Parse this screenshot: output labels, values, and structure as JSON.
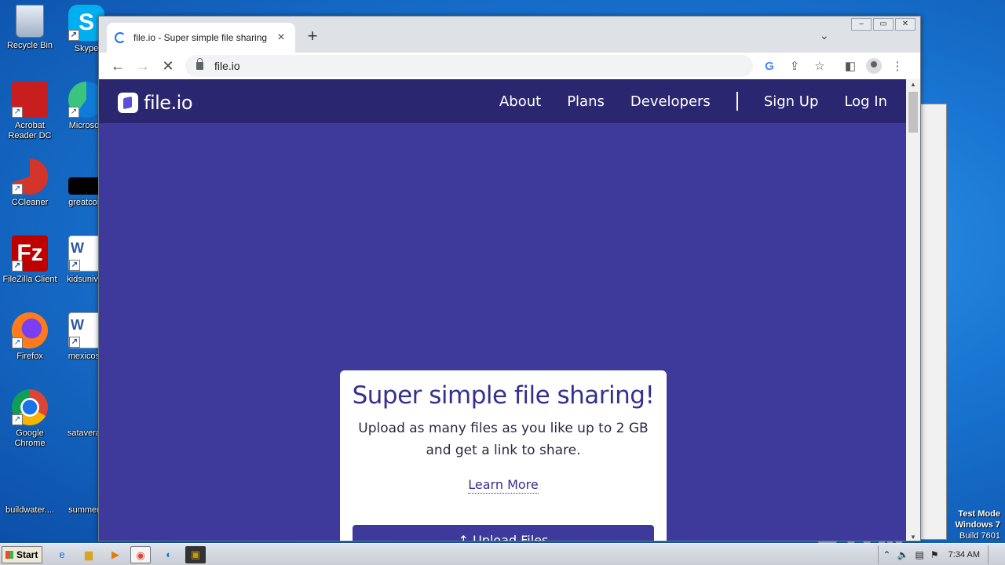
{
  "desktop": {
    "icons": [
      {
        "label": "Recycle Bin",
        "icon": "recycle-bin-icon"
      },
      {
        "label": "Skype",
        "icon": "skype-icon"
      },
      {
        "label": "Acrobat Reader DC",
        "icon": "acrobat-icon"
      },
      {
        "label": "Microsoft",
        "icon": "edge-icon"
      },
      {
        "label": "CCleaner",
        "icon": "ccleaner-icon"
      },
      {
        "label": "greatcom",
        "icon": "black-file-icon"
      },
      {
        "label": "FileZilla Client",
        "icon": "filezilla-icon"
      },
      {
        "label": "kidsuniver",
        "icon": "word-doc-icon"
      },
      {
        "label": "Firefox",
        "icon": "firefox-icon"
      },
      {
        "label": "mexicose",
        "icon": "word-doc-icon"
      },
      {
        "label": "Google Chrome",
        "icon": "chrome-icon"
      },
      {
        "label": "sataverag",
        "icon": "blank-file-icon"
      },
      {
        "label": "buildwater....",
        "icon": "blank-file-icon"
      },
      {
        "label": "summerg",
        "icon": "blank-file-icon"
      }
    ],
    "watermark": "ANY RUN",
    "testmode": {
      "line1": "Test Mode",
      "line2": "Windows 7",
      "line3": "Build 7601"
    }
  },
  "browser": {
    "tab_title": "file.io - Super simple file sharing",
    "tab_close": "×",
    "new_tab": "+",
    "tab_search": "⌄",
    "url": "file.io",
    "win_controls": {
      "minimize": "‒",
      "maximize": "▭",
      "close": "✕"
    }
  },
  "site": {
    "logo_text": "file.io",
    "nav": {
      "about": "About",
      "plans": "Plans",
      "developers": "Developers",
      "signup": "Sign Up",
      "login": "Log In"
    },
    "card": {
      "heading": "Super simple file sharing!",
      "description": "Upload as many files as you like up to 2 GB and get a link to share.",
      "learn_more": "Learn More",
      "upload": "↑ Upload Files"
    }
  },
  "taskbar": {
    "start_label": "Start",
    "clock": "7:34 AM"
  },
  "colors": {
    "site_nav": "#2a2770",
    "site_bg": "#3d3a9c",
    "heading": "#35308c"
  }
}
